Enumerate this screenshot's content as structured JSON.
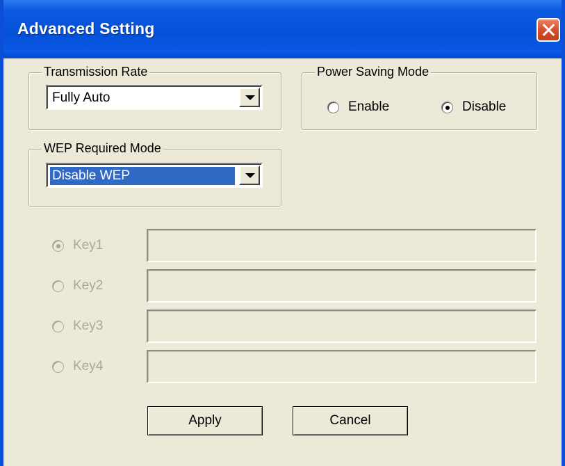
{
  "window": {
    "title": "Advanced Setting",
    "close_icon": "close-icon"
  },
  "transmission": {
    "label": "Transmission Rate",
    "value": "Fully Auto"
  },
  "power_saving": {
    "label": "Power Saving Mode",
    "options": [
      "Enable",
      "Disable"
    ],
    "selected": "Disable"
  },
  "wep": {
    "label": "WEP Required Mode",
    "value": "Disable WEP"
  },
  "keys": {
    "selected": "Key1",
    "items": [
      {
        "label": "Key1",
        "value": ""
      },
      {
        "label": "Key2",
        "value": ""
      },
      {
        "label": "Key3",
        "value": ""
      },
      {
        "label": "Key4",
        "value": ""
      }
    ],
    "enabled": false
  },
  "buttons": {
    "apply": "Apply",
    "cancel": "Cancel"
  },
  "colors": {
    "titlebar": "#0a4fd6",
    "dialog_bg": "#ece9d8",
    "selection": "#316ac5",
    "close_button": "#d8522e"
  }
}
